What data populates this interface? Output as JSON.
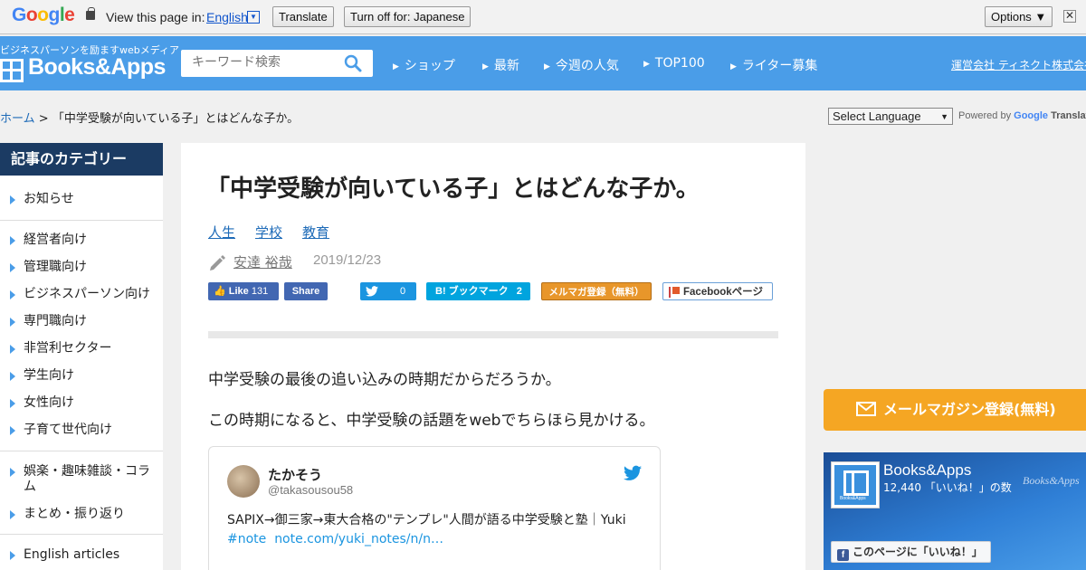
{
  "translate_bar": {
    "logo": "Google",
    "view_label": "View this page in:",
    "language": "English",
    "translate_button": "Translate",
    "turn_off_button": "Turn off for: Japanese",
    "options_button": "Options ▼",
    "close": "✕"
  },
  "header": {
    "tagline": "ビジネスパーソンを励ますwebメディア",
    "logo": "Books&Apps",
    "search_placeholder": "キーワード検索",
    "nav": [
      "ショップ",
      "最新",
      "今週の人気",
      "TOP100",
      "ライター募集"
    ],
    "company_link": "運営会社 ティネクト株式会社"
  },
  "breadcrumb": {
    "home": "ホーム",
    "separator": ">",
    "current": "「中学受験が向いている子」とはどんな子か。"
  },
  "google_translate_widget": {
    "select_label": "Select Language",
    "powered_by": "Powered by",
    "google": "Google",
    "translate": "Translate"
  },
  "sidebar": {
    "heading": "記事のカテゴリー",
    "items": [
      "お知らせ",
      "経営者向け",
      "管理職向け",
      "ビジネスパーソン向け",
      "専門職向け",
      "非営利セクター",
      "学生向け",
      "女性向け",
      "子育て世代向け",
      "娯楽・趣味雑談・コラム",
      "まとめ・振り返り",
      "English articles"
    ]
  },
  "article": {
    "title": "「中学受験が向いている子」とはどんな子か。",
    "tags": [
      "人生",
      "学校",
      "教育"
    ],
    "author": "安達 裕哉",
    "date": "2019/12/23",
    "share": {
      "fb_like": "Like",
      "fb_like_count": "131",
      "fb_share": "Share",
      "tweet_count": "0",
      "hatena_label": "B! ブックマーク",
      "hatena_count": "2",
      "mailmag": "メルマガ登録（無料）",
      "fb_page": "Facebookページ"
    },
    "paragraphs": [
      "中学受験の最後の追い込みの時期だからだろうか。",
      "この時期になると、中学受験の話題をwebでちらほら見かける。"
    ],
    "tweet": {
      "name": "たかそう",
      "handle": "@takasousou58",
      "text": "SAPIX→御三家→東大合格の\"テンプレ\"人間が語る中学受験と塾｜Yuki",
      "hashtag": "#note",
      "link": "note.com/yuki_notes/n/n…"
    }
  },
  "right_column": {
    "mail_banner": "メールマガジン登録(無料)",
    "fb_widget": {
      "page_name": "Books&Apps",
      "like_count": "12,440 「いいね！」の数",
      "watermark": "Books&Apps",
      "logo_caption": "Books&Apps",
      "like_button": "このページに「いいね！」"
    }
  },
  "colors": {
    "header_blue": "#4a9de8",
    "sidebar_head": "#1b3b63",
    "link_blue": "#1e6bb8",
    "mail_orange": "#f5a623",
    "facebook_blue": "#4267b2",
    "twitter_blue": "#1b95e0",
    "hatena_blue": "#00a4de"
  }
}
